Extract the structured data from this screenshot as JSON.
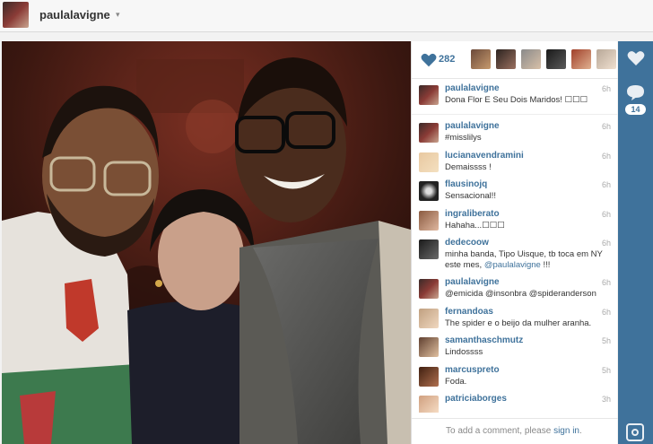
{
  "header": {
    "username": "paulalavigne",
    "caret": "▾"
  },
  "likes": {
    "count": "282",
    "liker_avatars": [
      "liker-1",
      "liker-2",
      "liker-3",
      "liker-4",
      "liker-5",
      "liker-6"
    ]
  },
  "comments": [
    {
      "user": "paulalavigne",
      "text": "Dona Flor E Seu Dois Maridos! ☐☐☐",
      "time": "6h"
    },
    {
      "user": "paulalavigne",
      "text": "#misslilys",
      "time": "6h"
    },
    {
      "user": "lucianavendramini",
      "text": "Demaissss !",
      "time": "6h"
    },
    {
      "user": "flausinojq",
      "text": "Sensacional!!",
      "time": "6h"
    },
    {
      "user": "ingraliberato",
      "text": "Hahaha...☐☐☐",
      "time": "6h"
    },
    {
      "user": "dedecoow",
      "text_before": "minha banda, Tipo Uisque, tb toca em NY este mes, ",
      "mention": "@paulalavigne",
      "text_after": " !!!",
      "time": "6h"
    },
    {
      "user": "paulalavigne",
      "mention": "@emicida @insonbra @spideranderson",
      "time": "6h"
    },
    {
      "user": "fernandoas",
      "text": "The spider e o beijo da mulher aranha.",
      "time": "6h"
    },
    {
      "user": "samanthaschmutz",
      "text": "Lindossss",
      "time": "5h"
    },
    {
      "user": "marcuspreto",
      "text": "Foda.",
      "time": "5h"
    },
    {
      "user": "patriciaborges",
      "text": "",
      "time": "3h"
    }
  ],
  "add_comment": {
    "prefix": "To add a comment, please ",
    "link": "sign in",
    "suffix": "."
  },
  "rail": {
    "comment_count": "14"
  },
  "colors": {
    "accent": "#3f729b",
    "rail": "#3f729b"
  }
}
